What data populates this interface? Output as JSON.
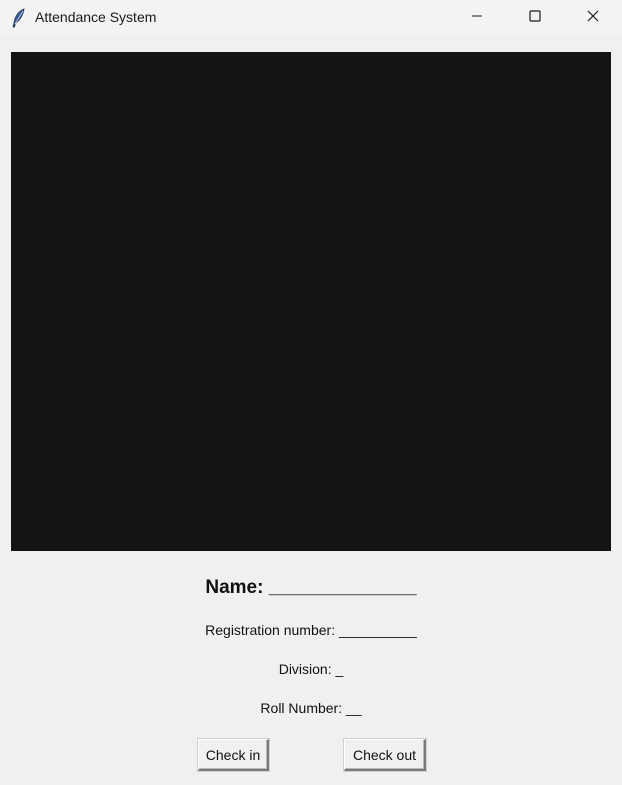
{
  "window": {
    "title": "Attendance System",
    "icon": "feather-icon",
    "controls": {
      "minimize_icon": "minimize-icon",
      "maximize_icon": "maximize-icon",
      "close_icon": "close-icon"
    }
  },
  "camera": {
    "background_color": "#141414"
  },
  "student": {
    "name_text": "Name: ______________",
    "registration_text": "Registration number: __________",
    "division_text": "Division: _",
    "roll_number_text": "Roll Number: __"
  },
  "actions": {
    "check_in_label": "Check in",
    "check_out_label": "Check out"
  }
}
